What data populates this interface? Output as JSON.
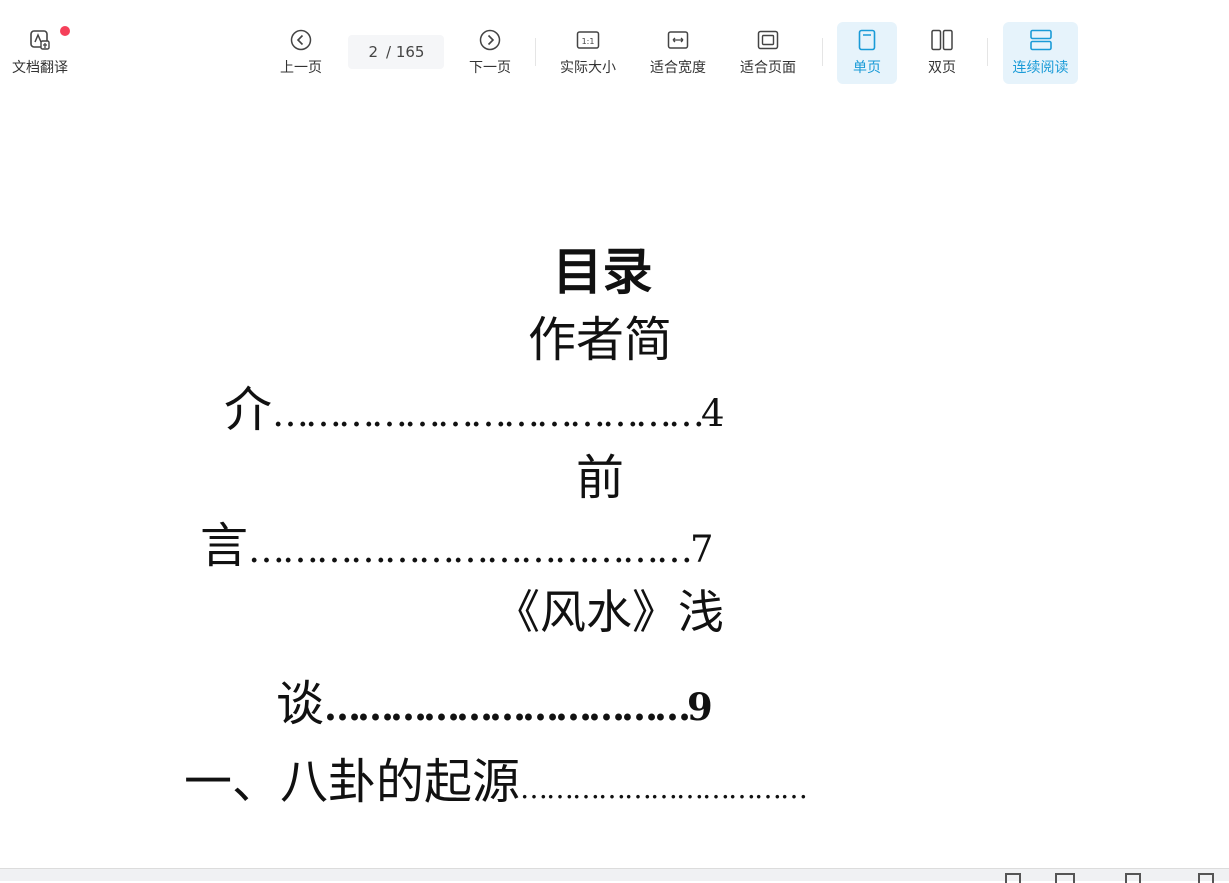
{
  "toolbar": {
    "translate_label": "文档翻译",
    "prev_label": "上一页",
    "current_page": "2",
    "total_pages": "/ 165",
    "next_label": "下一页",
    "actual_size_label": "实际大小",
    "fit_width_label": "适合宽度",
    "fit_page_label": "适合页面",
    "single_page_label": "单页",
    "double_page_label": "双页",
    "continuous_label": "连续阅读"
  },
  "document": {
    "title": "目录",
    "lines": [
      "作者简",
      "介",
      "…………………………………4",
      "前",
      "言",
      "…………………………………7",
      "《风水》浅",
      "谈",
      "……………………………9",
      "一、八卦的起源",
      "……………………………"
    ]
  },
  "colors": {
    "accent": "#1a9bd7",
    "active_bg": "#e6f3fb",
    "badge": "#f5405a"
  }
}
